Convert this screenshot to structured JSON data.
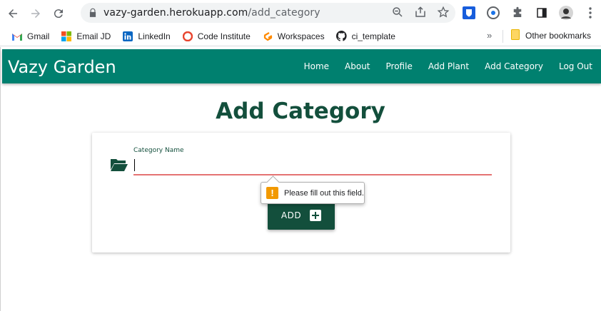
{
  "browser": {
    "url_host": "vazy-garden.herokuapp.com",
    "url_path": "/add_category",
    "bookmarks": [
      {
        "label": "Gmail",
        "icon": "gmail-icon"
      },
      {
        "label": "Email JD",
        "icon": "microsoft-icon"
      },
      {
        "label": "LinkedIn",
        "icon": "linkedin-icon"
      },
      {
        "label": "Code Institute",
        "icon": "code-institute-icon"
      },
      {
        "label": "Workspaces",
        "icon": "gitpod-icon"
      },
      {
        "label": "ci_template",
        "icon": "github-icon"
      }
    ],
    "more_bookmarks": "»",
    "other_bookmarks": "Other bookmarks"
  },
  "site": {
    "brand": "Vazy Garden",
    "nav": [
      "Home",
      "About",
      "Profile",
      "Add Plant",
      "Add Category",
      "Log Out"
    ],
    "brand_color": "#00806f",
    "accent_color": "#134f3c"
  },
  "form": {
    "title": "Add Category",
    "field_label": "Category Name",
    "field_value": "",
    "add_label": "ADD",
    "validation_message": "Please fill out this field.",
    "error_color": "#e57373"
  }
}
